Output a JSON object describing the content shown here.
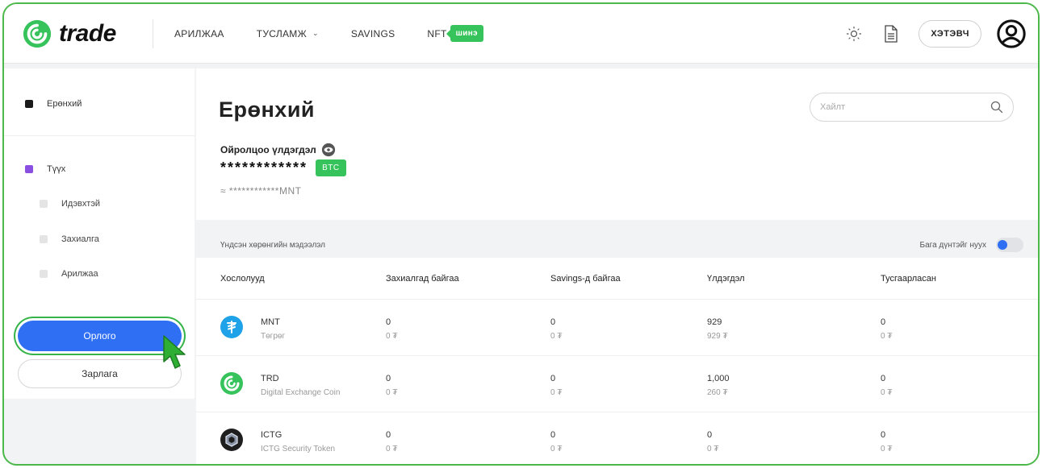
{
  "header": {
    "logo_text": "trade",
    "nav": [
      {
        "label": "АРИЛЖАА"
      },
      {
        "label": "ТУСЛАМЖ"
      },
      {
        "label": "SAVINGS"
      },
      {
        "label": "NFT"
      }
    ],
    "new_badge": "шинэ",
    "logout_label": "ХЭТЭВЧ"
  },
  "sidebar": {
    "general": "Ерөнхий",
    "history": "Түүх",
    "sub_items": [
      "Идэвхтэй",
      "Захиалга",
      "Арилжаа"
    ],
    "deposit_label": "Орлого",
    "withdraw_label": "Зарлага"
  },
  "main": {
    "title": "Ерөнхий",
    "search_placeholder": "Хайлт",
    "balance_label": "Ойролцоо үлдэгдэл",
    "balance_masked": "************",
    "balance_currency": "BTC",
    "balance_approx": "≈ ************MNT",
    "info_title": "Үндсэн хөрөнгийн мэдээлэл",
    "hide_small_label": "Бага дүнтэйг нуух",
    "hide_small_on": true
  },
  "table": {
    "headers": [
      "Хослолууд",
      "Захиалгад байгаа",
      "Savings-д байгаа",
      "Үлдэгдэл",
      "Тусгаарласан"
    ],
    "rows": [
      {
        "icon": "tugrik-coin-icon",
        "code": "MNT",
        "name": "Төгрөг",
        "order": "0",
        "order_mnt": "0 ₮",
        "savings": "0",
        "savings_mnt": "0 ₮",
        "balance": "929",
        "balance_mnt": "929 ₮",
        "reserved": "0",
        "reserved_mnt": "0 ₮"
      },
      {
        "icon": "trd-coin-icon",
        "code": "TRD",
        "name": "Digital Exchange Coin",
        "order": "0",
        "order_mnt": "0 ₮",
        "savings": "0",
        "savings_mnt": "0 ₮",
        "balance": "1,000",
        "balance_mnt": "260 ₮",
        "reserved": "0",
        "reserved_mnt": "0 ₮"
      },
      {
        "icon": "ictg-coin-icon",
        "code": "ICTG",
        "name": "ICTG Security Token",
        "order": "0",
        "order_mnt": "0 ₮",
        "savings": "0",
        "savings_mnt": "0 ₮",
        "balance": "0",
        "balance_mnt": "0 ₮",
        "reserved": "0",
        "reserved_mnt": "0 ₮"
      }
    ]
  },
  "colors": {
    "brand_green": "#36c35b",
    "accent_blue": "#2f6ff3",
    "frame_green": "#4cb84a",
    "history_dot": "#8a4fe0"
  }
}
